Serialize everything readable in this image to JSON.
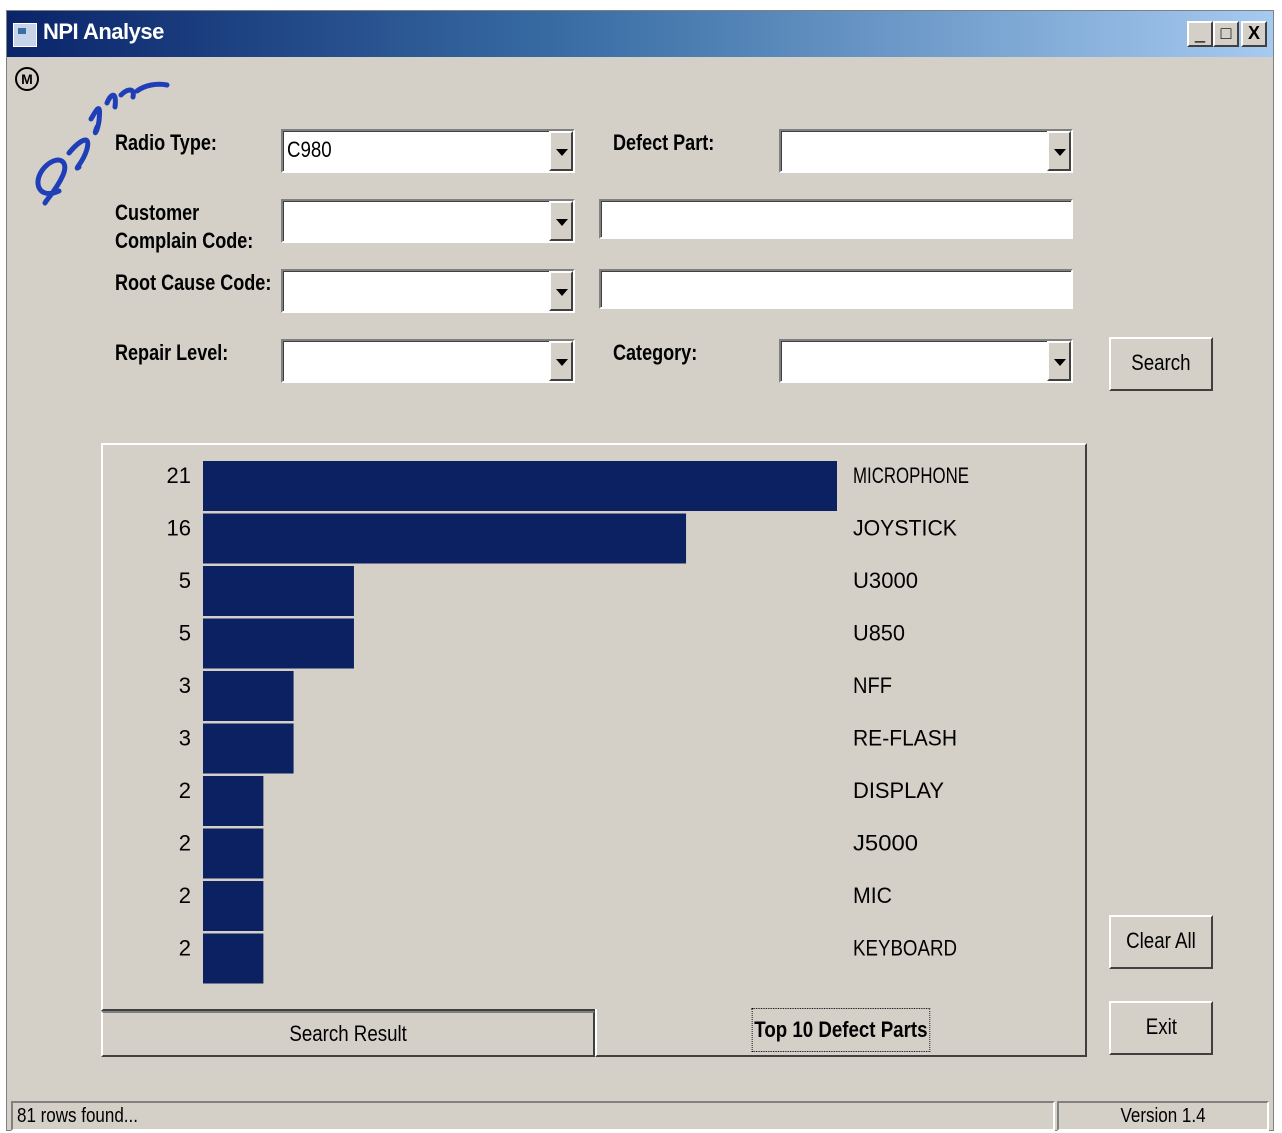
{
  "window": {
    "title": "NPI Analyse",
    "minimize_glyph": "_",
    "maximize_glyph": "□",
    "close_glyph": "X"
  },
  "form": {
    "radio_type_label": "Radio Type:",
    "radio_type_value": "C980",
    "defect_part_label": "Defect Part:",
    "defect_part_value": "",
    "customer_label_line1": "Customer",
    "customer_label_line2": "Complain Code:",
    "customer_code_value": "",
    "customer_code_text": "",
    "root_cause_label": "Root Cause Code:",
    "root_cause_value": "",
    "root_cause_text": "",
    "repair_level_label": "Repair Level:",
    "repair_level_value": "",
    "category_label": "Category:",
    "category_value": ""
  },
  "buttons": {
    "search": "Search",
    "clear_all": "Clear All",
    "exit": "Exit"
  },
  "tabs": [
    {
      "label": "Search Result",
      "active": false
    },
    {
      "label": "Top 10 Defect Parts",
      "active": true
    }
  ],
  "chart_data": {
    "type": "bar",
    "orientation": "horizontal",
    "categories": [
      "MICROPHONE",
      "JOYSTICK",
      "U3000",
      "U850",
      "NFF",
      "RE-FLASH",
      "DISPLAY",
      "J5000",
      "MIC",
      "KEYBOARD"
    ],
    "values": [
      21,
      16,
      5,
      5,
      3,
      3,
      2,
      2,
      2,
      2
    ],
    "bar_color": "#0c2161",
    "title": "",
    "xlabel": "",
    "ylabel": "",
    "grid": false,
    "legend": "none"
  },
  "status": {
    "rows_text": "81 rows found...",
    "version_text": "Version 1.4"
  }
}
